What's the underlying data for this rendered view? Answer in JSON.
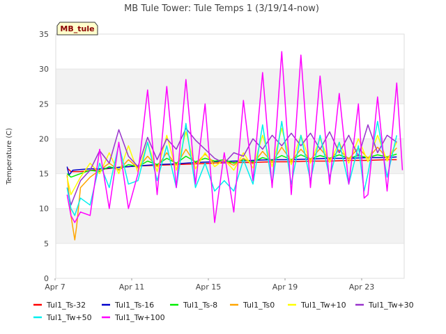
{
  "chart_data": {
    "type": "line",
    "title": "MB Tule Tower: Tule Temps 1 (3/19/14-now)",
    "site_label": "MB_tule",
    "xlabel": "",
    "ylabel": "Temperature (C)",
    "ylim": [
      0,
      35
    ],
    "y_ticks": [
      0,
      5,
      10,
      15,
      20,
      25,
      30,
      35
    ],
    "xlim_days": [
      0,
      18
    ],
    "x_ticks": [
      {
        "day": 0,
        "label": "Apr 7"
      },
      {
        "day": 4,
        "label": "Apr 11"
      },
      {
        "day": 8,
        "label": "Apr 15"
      },
      {
        "day": 12,
        "label": "Apr 19"
      },
      {
        "day": 16,
        "label": "Apr 23"
      }
    ],
    "grid": "horizontal alternating bands",
    "legend_position": "bottom",
    "series": [
      {
        "name": "Tul1_Ts-32",
        "color": "#ff0000",
        "points": [
          [
            0.3,
            15.8
          ],
          [
            0.5,
            15.3
          ],
          [
            1,
            15.3
          ],
          [
            2,
            15.6
          ],
          [
            3,
            15.9
          ],
          [
            4,
            16.1
          ],
          [
            5,
            16.2
          ],
          [
            6,
            16.3
          ],
          [
            7,
            16.4
          ],
          [
            8,
            16.5
          ],
          [
            9,
            16.6
          ],
          [
            10,
            16.6
          ],
          [
            11,
            16.7
          ],
          [
            12,
            16.7
          ],
          [
            13,
            16.8
          ],
          [
            14,
            16.8
          ],
          [
            15,
            16.9
          ],
          [
            16,
            16.9
          ],
          [
            17,
            17.0
          ],
          [
            17.5,
            17.0
          ]
        ]
      },
      {
        "name": "Tul1_Ts-16",
        "color": "#0000cc",
        "points": [
          [
            0.3,
            16.0
          ],
          [
            0.4,
            14.8
          ],
          [
            0.6,
            15.5
          ],
          [
            1,
            15.6
          ],
          [
            1.5,
            15.7
          ],
          [
            2,
            15.7
          ],
          [
            3,
            15.9
          ],
          [
            4,
            16.1
          ],
          [
            5,
            16.3
          ],
          [
            6,
            16.4
          ],
          [
            7,
            16.6
          ],
          [
            8,
            16.7
          ],
          [
            9,
            16.8
          ],
          [
            10,
            16.9
          ],
          [
            11,
            17.0
          ],
          [
            12,
            17.0
          ],
          [
            13,
            17.1
          ],
          [
            14,
            17.2
          ],
          [
            15,
            17.2
          ],
          [
            16,
            17.3
          ],
          [
            17,
            17.3
          ],
          [
            17.5,
            17.4
          ]
        ]
      },
      {
        "name": "Tul1_Ts-8",
        "color": "#00ee00",
        "points": [
          [
            0.3,
            15.0
          ],
          [
            0.5,
            14.5
          ],
          [
            1,
            15.0
          ],
          [
            1.5,
            15.5
          ],
          [
            2,
            15.3
          ],
          [
            2.5,
            16.0
          ],
          [
            3,
            15.6
          ],
          [
            3.5,
            16.3
          ],
          [
            4,
            16.0
          ],
          [
            4.5,
            16.8
          ],
          [
            5,
            16.3
          ],
          [
            5.5,
            17.2
          ],
          [
            6,
            16.5
          ],
          [
            6.5,
            17.5
          ],
          [
            7,
            16.7
          ],
          [
            7.5,
            17.2
          ],
          [
            8,
            16.8
          ],
          [
            8.5,
            17.0
          ],
          [
            9,
            16.5
          ],
          [
            9.5,
            17.0
          ],
          [
            10,
            16.7
          ],
          [
            10.5,
            17.3
          ],
          [
            11,
            16.9
          ],
          [
            11.5,
            17.6
          ],
          [
            12,
            17.0
          ],
          [
            12.5,
            17.7
          ],
          [
            13,
            17.1
          ],
          [
            13.5,
            17.6
          ],
          [
            14,
            17.2
          ],
          [
            14.5,
            17.7
          ],
          [
            15,
            17.2
          ],
          [
            15.5,
            17.6
          ],
          [
            16,
            17.3
          ],
          [
            16.5,
            17.7
          ],
          [
            17,
            17.4
          ],
          [
            17.5,
            17.8
          ]
        ]
      },
      {
        "name": "Tul1_Ts0",
        "color": "#ffa500",
        "points": [
          [
            0.3,
            14.8
          ],
          [
            0.5,
            9.0
          ],
          [
            0.7,
            5.5
          ],
          [
            0.8,
            7.5
          ],
          [
            1,
            13.0
          ],
          [
            1.5,
            14.5
          ],
          [
            2,
            15.5
          ],
          [
            2.5,
            16.5
          ],
          [
            3,
            15.5
          ],
          [
            3.5,
            17.0
          ],
          [
            4,
            15.8
          ],
          [
            4.5,
            17.5
          ],
          [
            5,
            16.0
          ],
          [
            5.5,
            18.0
          ],
          [
            6,
            16.2
          ],
          [
            6.5,
            18.5
          ],
          [
            7,
            16.4
          ],
          [
            7.5,
            17.8
          ],
          [
            8,
            16.5
          ],
          [
            8.5,
            16.8
          ],
          [
            9,
            16.2
          ],
          [
            9.5,
            17.2
          ],
          [
            10,
            16.4
          ],
          [
            10.5,
            18.2
          ],
          [
            11,
            16.6
          ],
          [
            11.5,
            18.8
          ],
          [
            12,
            16.8
          ],
          [
            12.5,
            18.5
          ],
          [
            13,
            17.0
          ],
          [
            13.5,
            18.6
          ],
          [
            14,
            17.0
          ],
          [
            14.5,
            18.4
          ],
          [
            15,
            17.1
          ],
          [
            15.5,
            18.7
          ],
          [
            16,
            17.2
          ],
          [
            16.5,
            18.8
          ],
          [
            17,
            17.2
          ],
          [
            17.5,
            18.7
          ]
        ]
      },
      {
        "name": "Tul1_Tw+10",
        "color": "#ffff00",
        "points": [
          [
            0.3,
            14.5
          ],
          [
            0.5,
            12.0
          ],
          [
            1,
            14.5
          ],
          [
            1.5,
            16.5
          ],
          [
            2,
            15.0
          ],
          [
            2.5,
            18.0
          ],
          [
            3,
            15.0
          ],
          [
            3.5,
            19.0
          ],
          [
            4,
            15.2
          ],
          [
            4.5,
            19.5
          ],
          [
            5,
            15.3
          ],
          [
            5.5,
            20.5
          ],
          [
            6,
            15.5
          ],
          [
            6.5,
            21.0
          ],
          [
            7,
            15.7
          ],
          [
            7.5,
            18.0
          ],
          [
            8,
            16.0
          ],
          [
            8.5,
            17.0
          ],
          [
            9,
            15.5
          ],
          [
            9.5,
            18.0
          ],
          [
            10,
            15.8
          ],
          [
            10.5,
            20.5
          ],
          [
            11,
            16.0
          ],
          [
            11.5,
            21.5
          ],
          [
            12,
            16.3
          ],
          [
            12.5,
            20.5
          ],
          [
            13,
            16.5
          ],
          [
            13.5,
            20.0
          ],
          [
            14,
            16.6
          ],
          [
            14.5,
            19.5
          ],
          [
            15,
            16.5
          ],
          [
            15.5,
            20.0
          ],
          [
            16,
            16.7
          ],
          [
            16.5,
            20.5
          ],
          [
            17,
            16.8
          ],
          [
            17.5,
            19.5
          ]
        ]
      },
      {
        "name": "Tul1_Tw+30",
        "color": "#9933cc",
        "points": [
          [
            0.3,
            13.0
          ],
          [
            0.5,
            10.5
          ],
          [
            1,
            14.0
          ],
          [
            1.5,
            15.5
          ],
          [
            2,
            18.3
          ],
          [
            2.5,
            16.5
          ],
          [
            3,
            21.3
          ],
          [
            3.5,
            17.5
          ],
          [
            4,
            16.0
          ],
          [
            4.5,
            20.2
          ],
          [
            5,
            17.0
          ],
          [
            5.5,
            20.0
          ],
          [
            6,
            18.5
          ],
          [
            6.5,
            21.5
          ],
          [
            7,
            19.8
          ],
          [
            7.5,
            18.5
          ],
          [
            8,
            17.2
          ],
          [
            8.5,
            16.5
          ],
          [
            9,
            18.0
          ],
          [
            9.5,
            17.5
          ],
          [
            10,
            20.0
          ],
          [
            10.5,
            18.5
          ],
          [
            11,
            20.5
          ],
          [
            11.5,
            19.0
          ],
          [
            12,
            20.8
          ],
          [
            12.5,
            19.0
          ],
          [
            13,
            20.8
          ],
          [
            13.5,
            18.5
          ],
          [
            14,
            21.0
          ],
          [
            14.5,
            18.0
          ],
          [
            15,
            20.5
          ],
          [
            15.5,
            17.5
          ],
          [
            16,
            22.0
          ],
          [
            16.5,
            18.0
          ],
          [
            17,
            20.5
          ],
          [
            17.5,
            19.5
          ]
        ]
      },
      {
        "name": "Tul1_Tw+50",
        "color": "#00eeee",
        "points": [
          [
            0.3,
            13.0
          ],
          [
            0.5,
            10.0
          ],
          [
            0.7,
            9.0
          ],
          [
            1,
            11.5
          ],
          [
            1.5,
            10.5
          ],
          [
            2,
            16.5
          ],
          [
            2.5,
            13.0
          ],
          [
            3,
            19.2
          ],
          [
            3.5,
            13.5
          ],
          [
            4,
            14.0
          ],
          [
            4.5,
            19.5
          ],
          [
            5,
            14.0
          ],
          [
            5.5,
            19.0
          ],
          [
            6,
            13.0
          ],
          [
            6.5,
            22.2
          ],
          [
            7,
            13.0
          ],
          [
            7.5,
            16.5
          ],
          [
            8,
            12.5
          ],
          [
            8.5,
            14.0
          ],
          [
            9,
            12.5
          ],
          [
            9.5,
            17.0
          ],
          [
            10,
            13.5
          ],
          [
            10.5,
            22.0
          ],
          [
            11,
            13.5
          ],
          [
            11.5,
            22.5
          ],
          [
            12,
            13.5
          ],
          [
            12.5,
            20.5
          ],
          [
            13,
            14.0
          ],
          [
            13.5,
            20.5
          ],
          [
            14,
            14.5
          ],
          [
            14.5,
            19.5
          ],
          [
            15,
            13.5
          ],
          [
            15.5,
            19.0
          ],
          [
            15.8,
            12.5
          ],
          [
            16,
            15.0
          ],
          [
            16.5,
            22.5
          ],
          [
            17,
            14.5
          ],
          [
            17.5,
            20.5
          ]
        ]
      },
      {
        "name": "Tul1_Tw+100",
        "color": "#ff00ff",
        "points": [
          [
            0.3,
            12.0
          ],
          [
            0.5,
            9.0
          ],
          [
            0.7,
            8.0
          ],
          [
            1,
            9.5
          ],
          [
            1.5,
            9.0
          ],
          [
            2,
            18.5
          ],
          [
            2.5,
            10.0
          ],
          [
            3,
            19.5
          ],
          [
            3.5,
            10.0
          ],
          [
            4,
            15.0
          ],
          [
            4.5,
            27.0
          ],
          [
            5,
            12.0
          ],
          [
            5.5,
            27.5
          ],
          [
            6,
            13.0
          ],
          [
            6.5,
            28.5
          ],
          [
            7,
            13.5
          ],
          [
            7.5,
            25.0
          ],
          [
            8,
            8.0
          ],
          [
            8.5,
            18.0
          ],
          [
            9,
            9.5
          ],
          [
            9.5,
            25.5
          ],
          [
            10,
            14.0
          ],
          [
            10.5,
            29.5
          ],
          [
            11,
            13.0
          ],
          [
            11.5,
            32.5
          ],
          [
            12,
            12.0
          ],
          [
            12.5,
            32.0
          ],
          [
            13,
            13.0
          ],
          [
            13.5,
            29.0
          ],
          [
            14,
            13.5
          ],
          [
            14.5,
            26.5
          ],
          [
            15,
            13.5
          ],
          [
            15.5,
            25.0
          ],
          [
            15.8,
            11.5
          ],
          [
            16,
            12.0
          ],
          [
            16.5,
            26.0
          ],
          [
            17,
            12.5
          ],
          [
            17.5,
            28.0
          ],
          [
            17.8,
            15.5
          ]
        ]
      }
    ]
  }
}
